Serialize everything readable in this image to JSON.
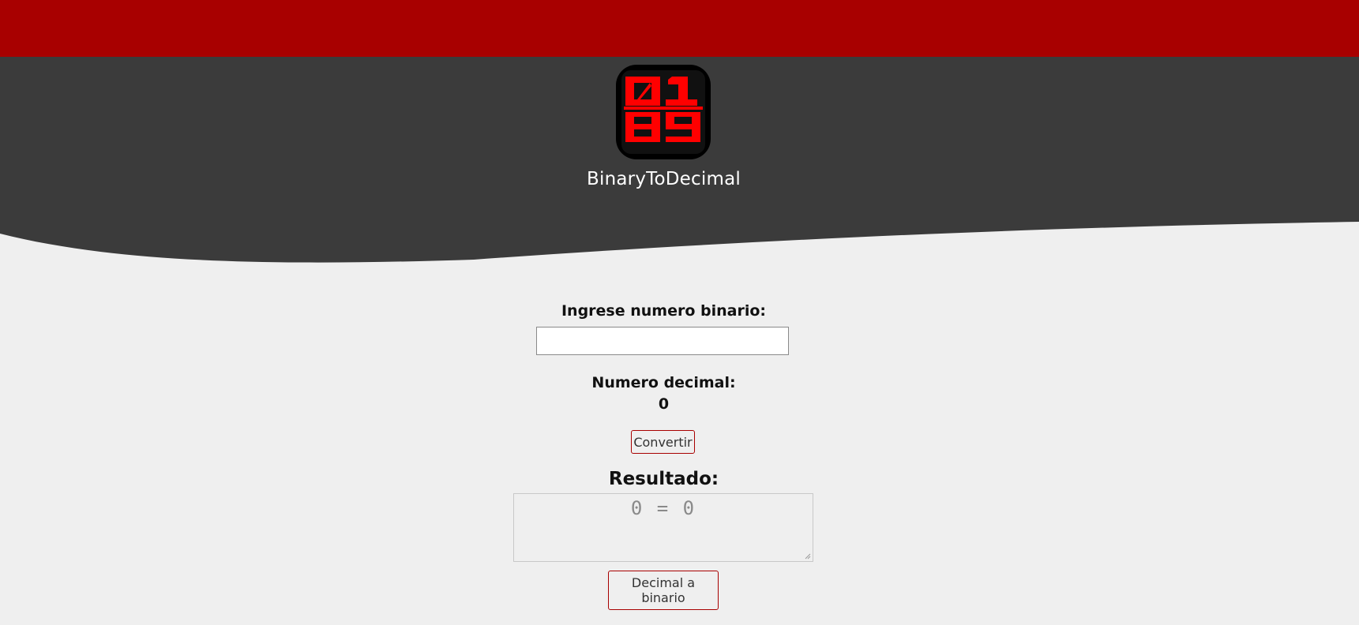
{
  "app": {
    "title": "BinaryToDecimal",
    "logo": {
      "icon": "binary-digits-logo-icon",
      "digits_top": "01",
      "digits_bottom": "89"
    }
  },
  "colors": {
    "top_bar": "#a80000",
    "header": "#3b3b3b",
    "background": "#efefef",
    "logo_digits": "#ff0000",
    "button_border": "#a80000"
  },
  "form": {
    "binary_label": "Ingrese numero binario:",
    "binary_value": "",
    "binary_placeholder": "",
    "decimal_label": "Numero decimal:",
    "decimal_value": "0",
    "convert_label": "Convertir",
    "result_label": "Resultado:",
    "result_text": "0 = 0",
    "switch_label": "Decimal a binario"
  }
}
